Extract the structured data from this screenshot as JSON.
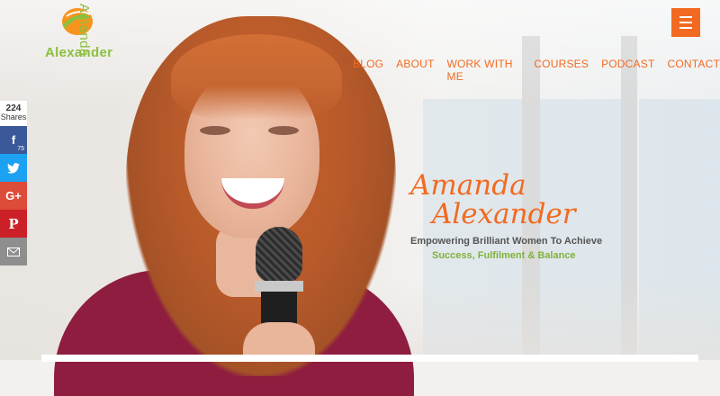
{
  "logo": {
    "first": "Amanda",
    "last": "Alexander"
  },
  "nav": {
    "items": [
      "BLOG",
      "ABOUT",
      "WORK WITH ME",
      "COURSES",
      "PODCAST",
      "CONTACT"
    ]
  },
  "share": {
    "count": "224",
    "label": "Shares",
    "facebook_count": "75"
  },
  "hero": {
    "name_first": "Amanda",
    "name_last": "Alexander",
    "tagline_line1": "Empowering Brilliant Women To Achieve",
    "tagline_line2": "Success, Fulfilment & Balance"
  },
  "colors": {
    "accent": "#f26a21",
    "green": "#7fb23a",
    "top": "#8e1d3f"
  },
  "icons": {
    "menu": "hamburger-icon",
    "facebook": "facebook-icon",
    "twitter": "twitter-icon",
    "google": "google-plus-icon",
    "pinterest": "pinterest-icon",
    "email": "email-icon"
  }
}
